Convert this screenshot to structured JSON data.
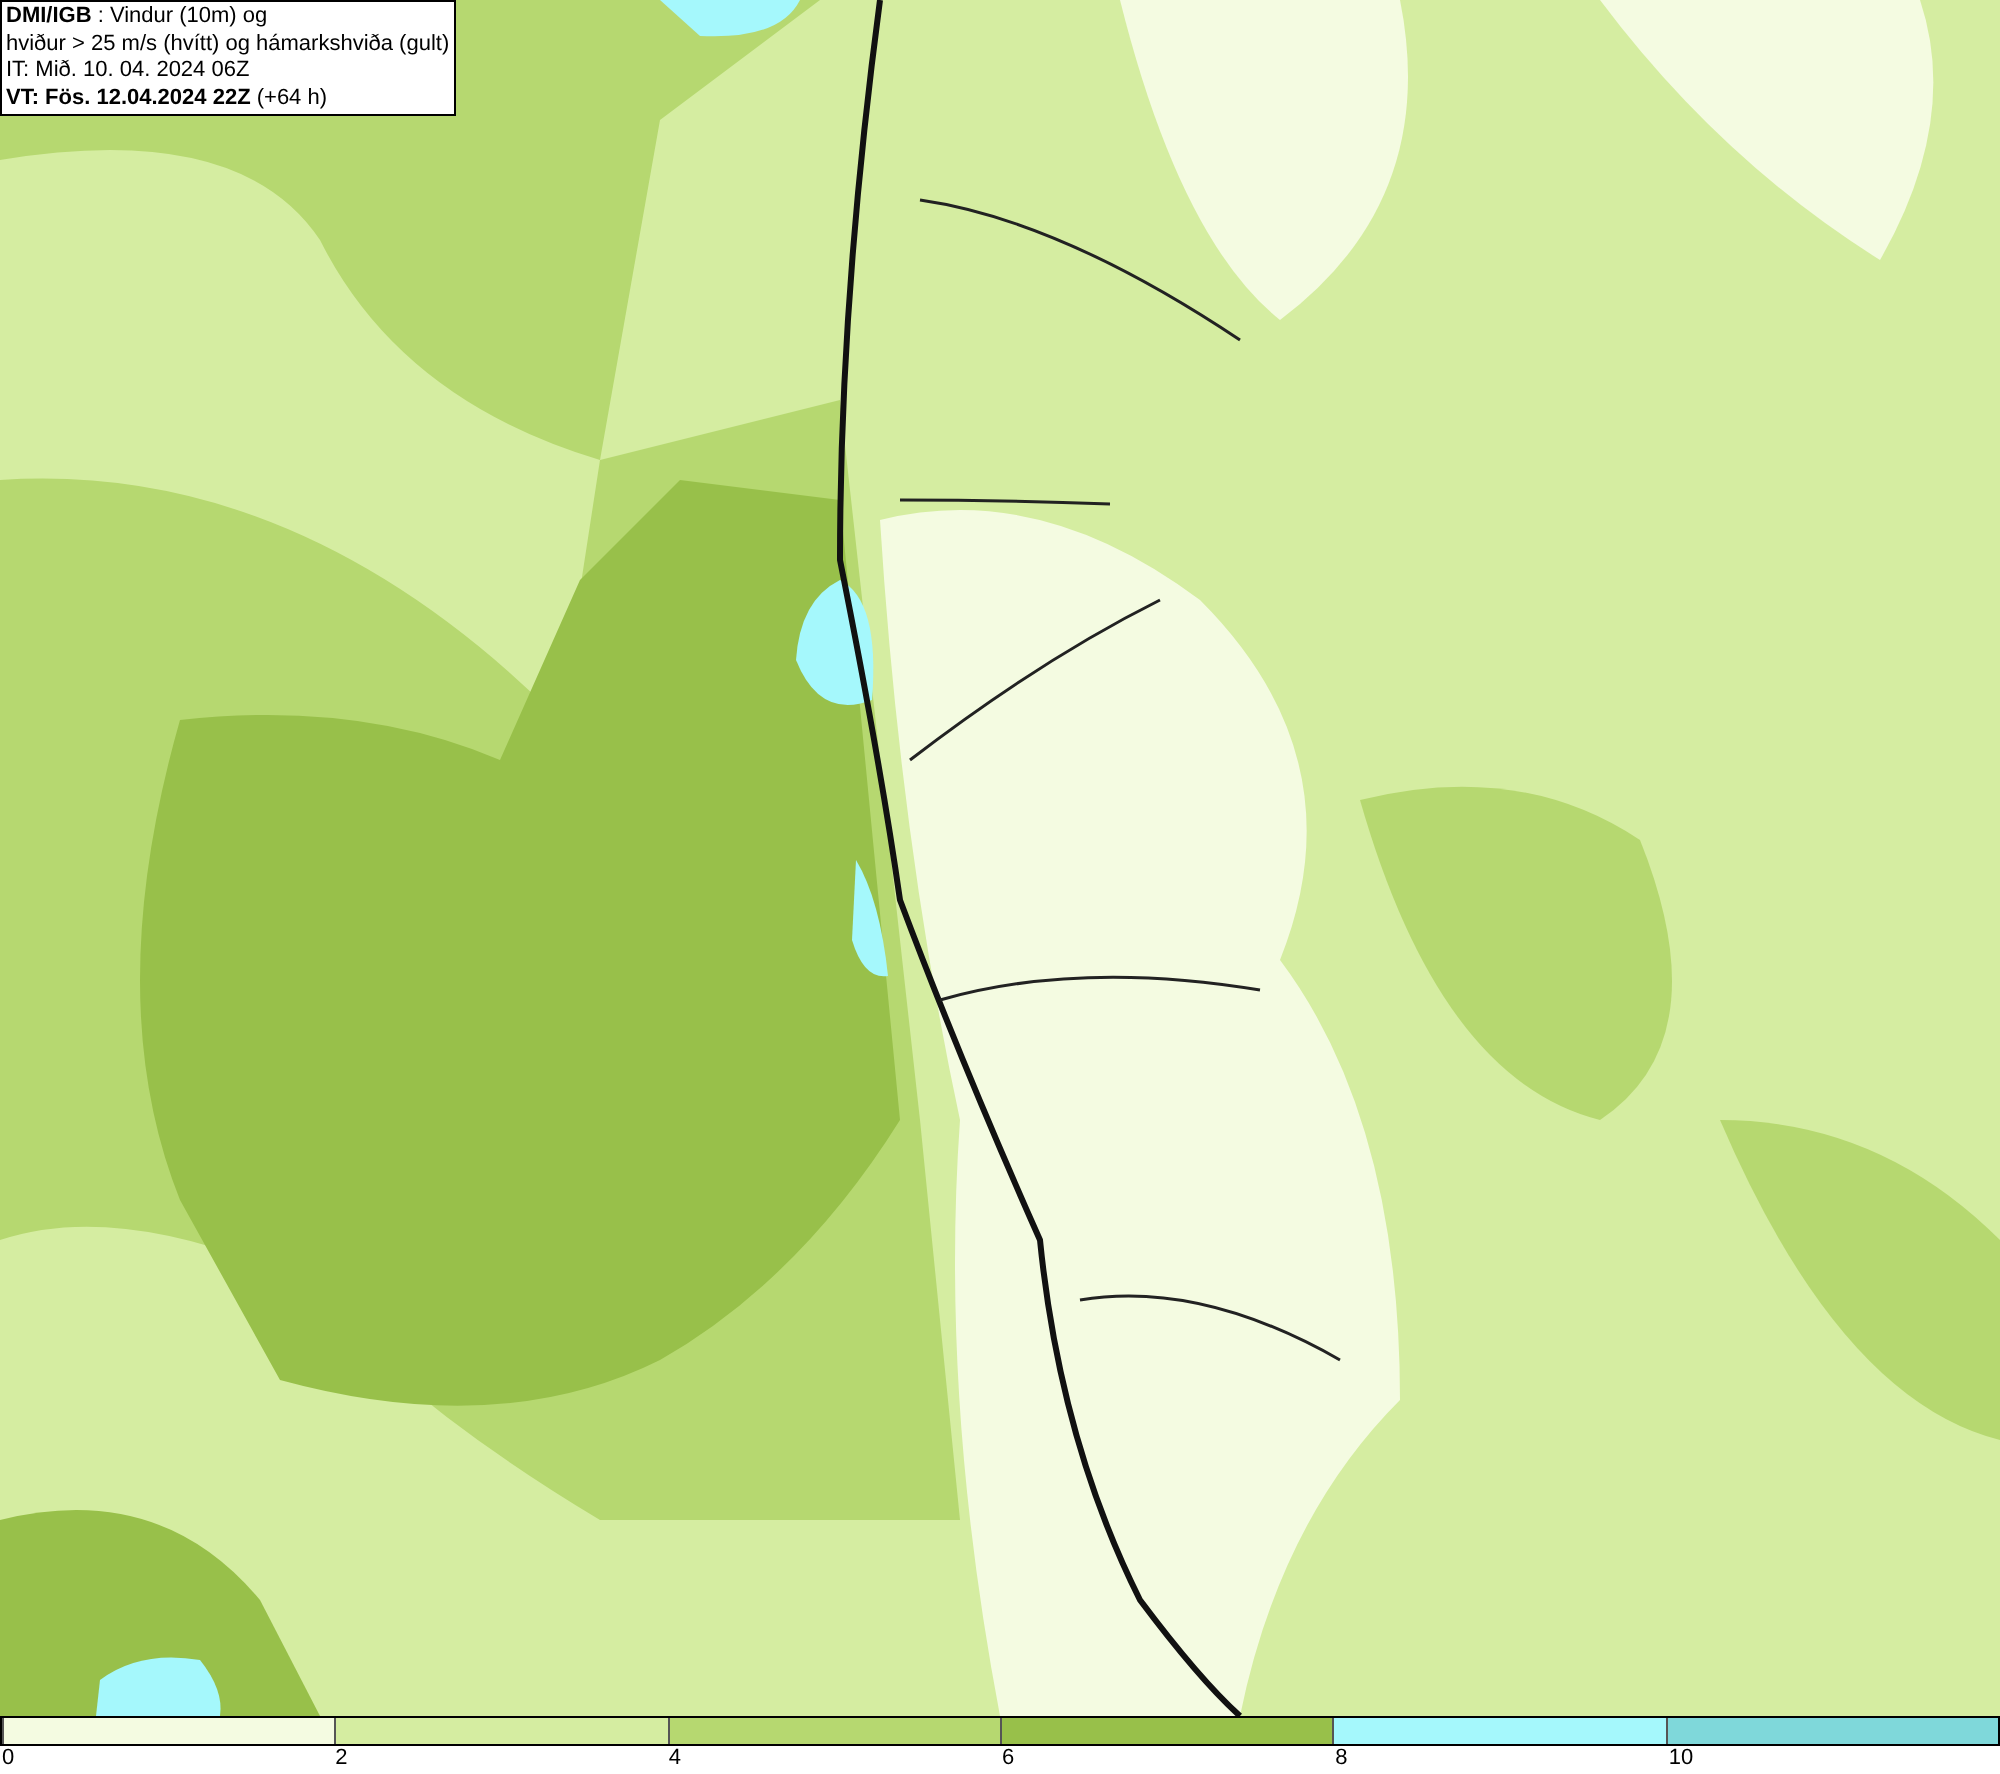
{
  "header": {
    "lines": [
      "**DMI/IGB** : Vindur (10m) og",
      "hviður > 25 m/s (hvítt) og hámarkshviða (gult)",
      "IT: Mið. 10. 04. 2024 06Z",
      "**VT: Fös. 12.04.2024 22Z** (+64 h)"
    ]
  },
  "legend": {
    "segments": [
      {
        "color": "#f4fbe1"
      },
      {
        "color": "#d5eda1"
      },
      {
        "color": "#b6d870"
      },
      {
        "color": "#98c04a"
      },
      {
        "color": "#a5f8fc"
      },
      {
        "color": "#7fd8da"
      }
    ],
    "ticks": [
      "0",
      "2",
      "4",
      "6",
      "8",
      "10"
    ]
  }
}
